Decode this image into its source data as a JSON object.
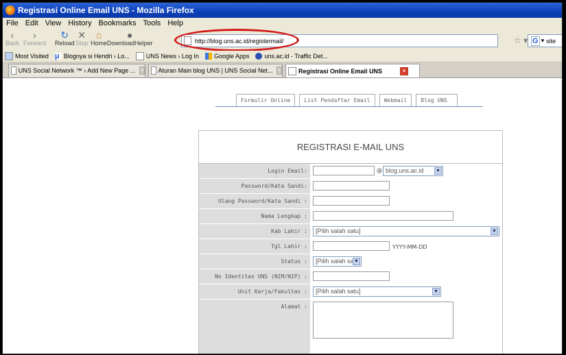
{
  "window": {
    "title": "Registrasi Online Email UNS - Mozilla Firefox"
  },
  "menu": [
    "File",
    "Edit",
    "View",
    "History",
    "Bookmarks",
    "Tools",
    "Help"
  ],
  "nav": {
    "back": "Back",
    "forward": "Forward",
    "reload": "Reload",
    "stop": "Stop",
    "home": "Home",
    "download_helper": "DownloadHelper",
    "url": "http://blog.uns.ac.id/registermail/",
    "search_engine_partial": "site"
  },
  "bookmarks": [
    "Most Visited",
    "Blognya si Hendri › Lo...",
    "UNS News › Log In",
    "Google Apps",
    "uns.ac.id - Traffic Det..."
  ],
  "tabs": [
    "UNS Social Network ™ › Add New Page ...",
    "Aturan Main blog UNS | UNS Social Net...",
    "Registrasi Online Email UNS"
  ],
  "page_nav": [
    "Formulir Online",
    "List Pendaftar Email",
    "Webmail",
    "Blog UNS"
  ],
  "form": {
    "title": "REGISTRASI E-MAIL UNS",
    "login_email_label": "Login Email:",
    "at_sign": "@",
    "domain_value": "blog.uns.ac.id",
    "password_label": "Password/Kata Sandi:",
    "repeat_password_label": "Ulang Password/Kata Sandi :",
    "full_name_label": "Nama Lengkap :",
    "birthplace_label": "Kab Lahir :",
    "birthplace_value": "[Pilih salah satu]",
    "birthdate_label": "Tgl Lahir :",
    "birthdate_hint": "YYYY-MM-DD",
    "status_label": "Status :",
    "status_value": "[Pilih salah satu]",
    "id_label": "No Identitas UNS (NIM/NIP) :",
    "unit_label": "Unit Kerja/Fakultas :",
    "unit_value": "[Pilih salah satu]",
    "address_label": "Alamat :"
  },
  "colors": {
    "highlight_oval": "#d21818",
    "title_bar": "#0a3fb8"
  }
}
